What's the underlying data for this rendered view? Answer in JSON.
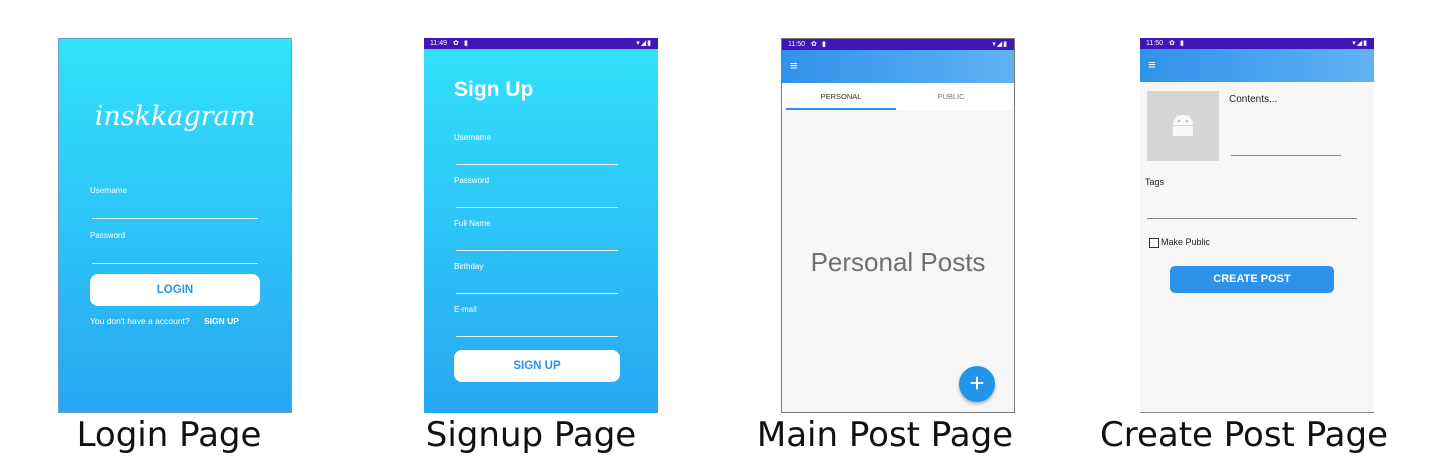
{
  "captions": [
    "Login Page",
    "Signup Page",
    "Main Post Page",
    "Create Post Page"
  ],
  "status_bar": {
    "signup_time": "11:49",
    "main_time": "11:50",
    "create_time": "11:50",
    "settings_glyph": "✿",
    "card_glyph": "▮",
    "signal_glyphs": "▾◢▮"
  },
  "login": {
    "logo": "inskkagram",
    "username_label": "Username",
    "password_label": "Password",
    "login_button": "LOGIN",
    "no_account_text": "You don't have a account?",
    "signup_link": "SIGN UP"
  },
  "signup": {
    "title": "Sign Up",
    "fields": [
      "Username",
      "Password",
      "Full Name",
      "Birthday",
      "E-mail"
    ],
    "signup_button": "SIGN UP"
  },
  "main": {
    "menu_glyph": "≡",
    "tabs": [
      "PERSONAL",
      "PUBLIC"
    ],
    "content_label": "Personal Posts",
    "fab_glyph": "+"
  },
  "create": {
    "menu_glyph": "≡",
    "contents_placeholder": "Contents...",
    "tags_label": "Tags",
    "make_public_label": "Make Public",
    "create_button": "CREATE POST"
  },
  "colors": {
    "gradient_top": "#33e2fb",
    "gradient_bottom": "#28a6f2",
    "status_bar": "#3f17b8",
    "accent": "#2c93ea"
  }
}
